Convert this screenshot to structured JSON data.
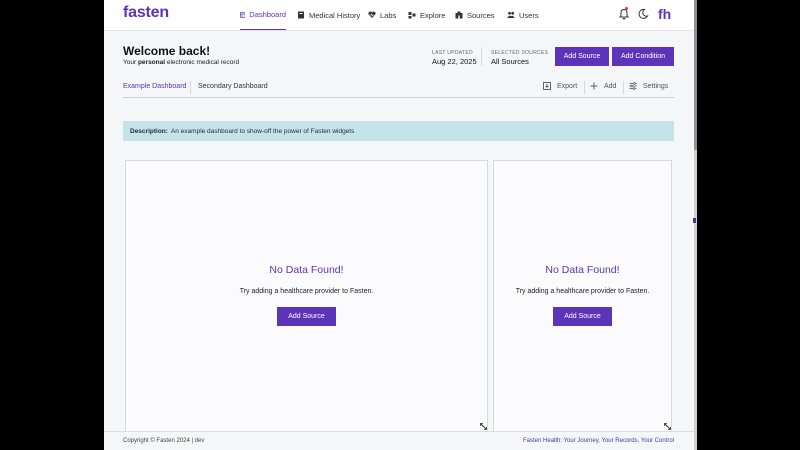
{
  "brand": {
    "logo": "fasten",
    "user_initials": "fh"
  },
  "nav": {
    "items": [
      {
        "label": "Dashboard",
        "icon": "dashboard-icon"
      },
      {
        "label": "Medical History",
        "icon": "book-icon"
      },
      {
        "label": "Labs",
        "icon": "heart-pulse-icon"
      },
      {
        "label": "Explore",
        "icon": "explore-icon"
      },
      {
        "label": "Sources",
        "icon": "building-icon"
      },
      {
        "label": "Users",
        "icon": "users-icon"
      }
    ],
    "active": "Dashboard"
  },
  "header": {
    "title": "Welcome back!",
    "subtitle_pre": "Your ",
    "subtitle_bold": "personal",
    "subtitle_post": " electronic medical record",
    "last_updated_label": "LAST UPDATED",
    "last_updated_value": "Aug 22, 2025",
    "selected_sources_label": "SELECTED SOURCES",
    "selected_sources_value": "All Sources",
    "add_source_label": "Add Source",
    "add_condition_label": "Add Condition"
  },
  "tabs": {
    "items": [
      "Example Dashboard",
      "Secondary Dashboard"
    ],
    "active": "Example Dashboard",
    "tools": {
      "export": "Export",
      "add": "Add",
      "settings": "Settings"
    }
  },
  "description": {
    "label": "Description:",
    "text": "An example dashboard to show-off the power of Fasten widgets"
  },
  "widgets": [
    {
      "title": "No Data Found!",
      "text": "Try adding a healthcare provider to Fasten.",
      "button": "Add Source"
    },
    {
      "title": "No Data Found!",
      "text": "Try adding a healthcare provider to Fasten.",
      "button": "Add Source"
    }
  ],
  "footer": {
    "left": "Copyright © Fasten 2024 | dev",
    "right": "Fasten Health: Your Journey, Your Records, Your Control"
  },
  "colors": {
    "accent": "#5b34b9",
    "description_bg": "#c5e4ea",
    "link": "#3d3db0"
  }
}
